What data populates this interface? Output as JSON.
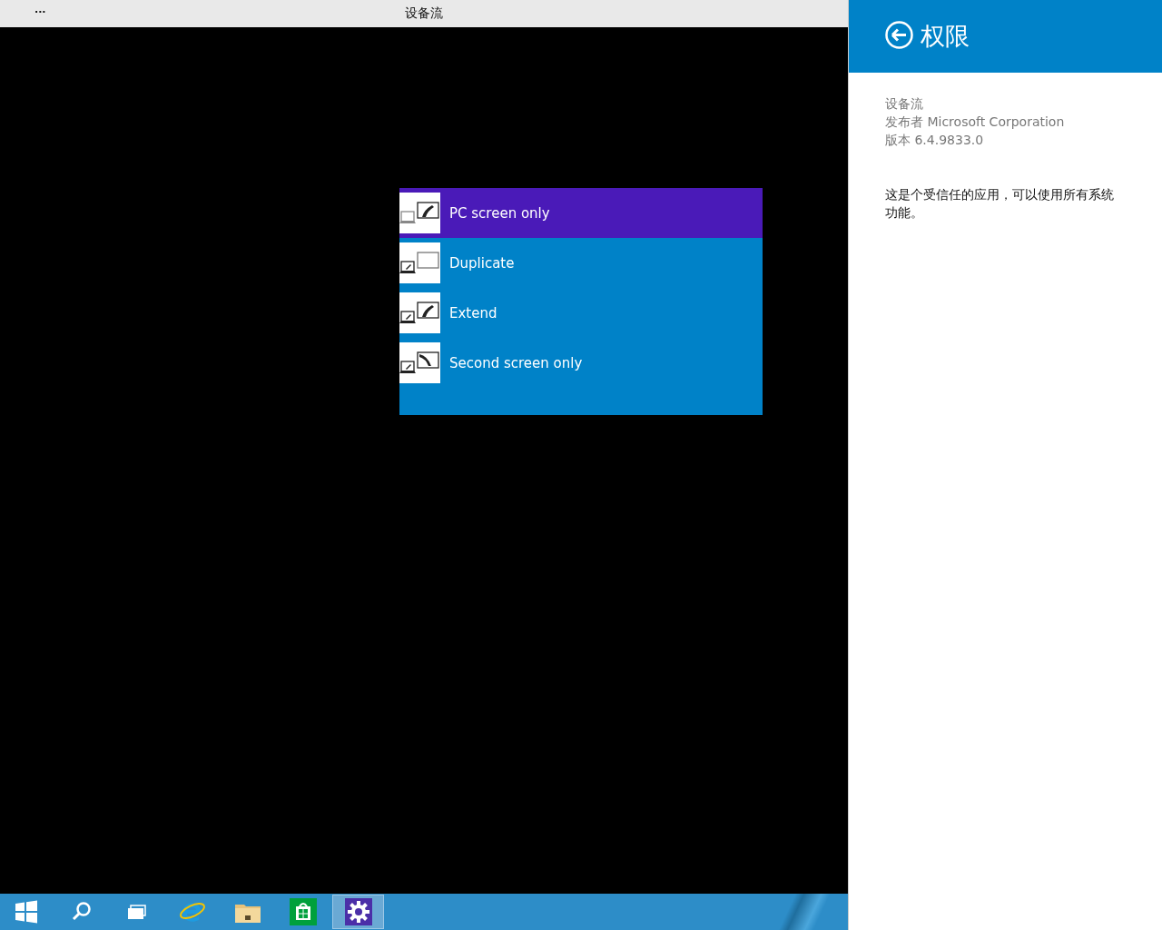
{
  "window": {
    "menu_glyph": "...",
    "title": "设备流"
  },
  "project_menu": {
    "items": [
      {
        "label": "PC screen only",
        "kind": "pc-only",
        "selected": true
      },
      {
        "label": "Duplicate",
        "kind": "duplicate",
        "selected": false
      },
      {
        "label": "Extend",
        "kind": "extend",
        "selected": false
      },
      {
        "label": "Second screen only",
        "kind": "second-only",
        "selected": false
      }
    ]
  },
  "taskbar": {
    "items": [
      {
        "kind": "start",
        "selected": false
      },
      {
        "kind": "search",
        "selected": false
      },
      {
        "kind": "task-view",
        "selected": false
      },
      {
        "kind": "browser",
        "selected": false
      },
      {
        "kind": "folder",
        "selected": false
      },
      {
        "kind": "store",
        "selected": false
      },
      {
        "kind": "settings",
        "selected": true
      }
    ]
  },
  "permissions_panel": {
    "title": "权限",
    "app_name": "设备流",
    "publisher": "发布者 Microsoft Corporation",
    "version": "版本 6.4.9833.0",
    "description": "这是个受信任的应用，可以使用所有系统功能。"
  }
}
